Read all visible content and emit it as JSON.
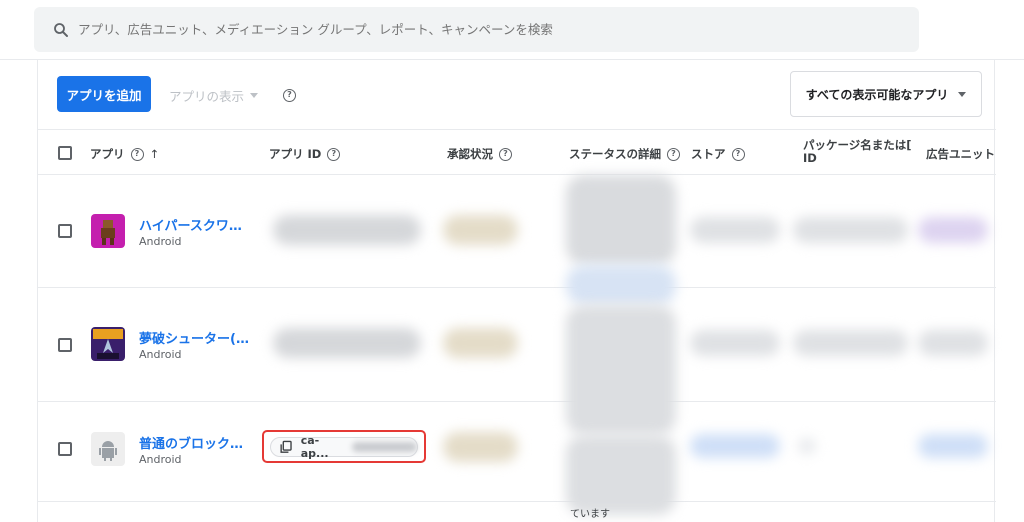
{
  "search": {
    "placeholder": "アプリ、広告ユニット、メディエーション グループ、レポート、キャンペーンを検索"
  },
  "toolbar": {
    "add_label": "アプリを追加",
    "view_label": "アプリの表示",
    "filter_label": "すべての表示可能なアプリ"
  },
  "columns": {
    "app": "アプリ",
    "app_id": "アプリ ID",
    "approval": "承認状況",
    "status_detail": "ステータスの詳細",
    "store": "ストア",
    "package": "パッケージ名または[",
    "package_line2": "ID",
    "ad_units": "広告ユニット"
  },
  "rows": [
    {
      "name": "ハイパースクワ…",
      "platform": "Android",
      "icon": "hyper-squad-app-icon"
    },
    {
      "name": "夢破シューター(…",
      "platform": "Android",
      "icon": "dream-shooter-app-icon"
    },
    {
      "name": "普通のブロック…",
      "platform": "Android",
      "icon": "android-icon",
      "app_id_text": "ca-ap..."
    }
  ],
  "status_fragments": {
    "bottom": "ています"
  },
  "colors": {
    "accent": "#1a73e8",
    "highlight_border": "#e53935"
  }
}
